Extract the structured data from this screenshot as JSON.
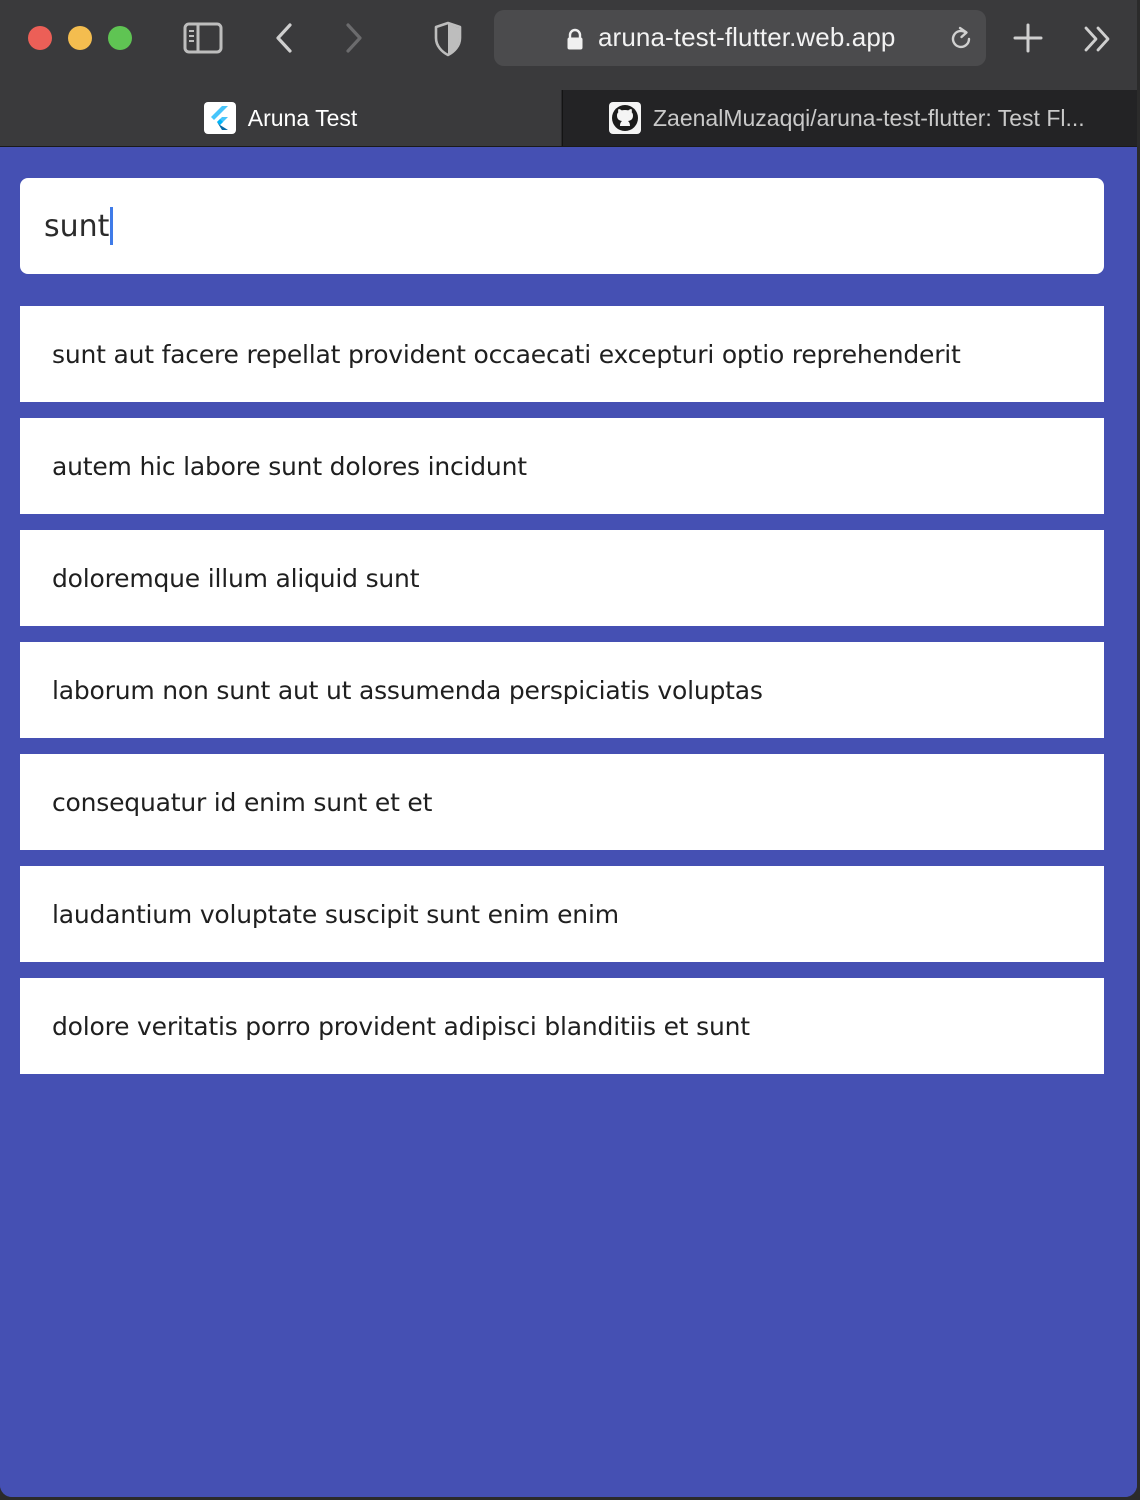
{
  "browser": {
    "url": "aruna-test-flutter.web.app",
    "tabs": [
      {
        "title": "Aruna Test",
        "favicon": "flutter-icon",
        "active": true
      },
      {
        "title": "ZaenalMuzaqqi/aruna-test-flutter: Test Fl...",
        "favicon": "github-icon",
        "active": false
      }
    ]
  },
  "search": {
    "value": "sunt"
  },
  "results": [
    "sunt aut facere repellat provident occaecati excepturi optio reprehenderit",
    "autem hic labore sunt dolores incidunt",
    "doloremque illum aliquid sunt",
    "laborum non sunt aut ut assumenda perspiciatis voluptas",
    "consequatur id enim sunt et et",
    "laudantium voluptate suscipit sunt enim enim",
    "dolore veritatis porro provident adipisci blanditiis et sunt"
  ],
  "colors": {
    "app_background": "#4550b3",
    "toolbar": "#3a3a3c",
    "caret": "#3f7be8"
  }
}
